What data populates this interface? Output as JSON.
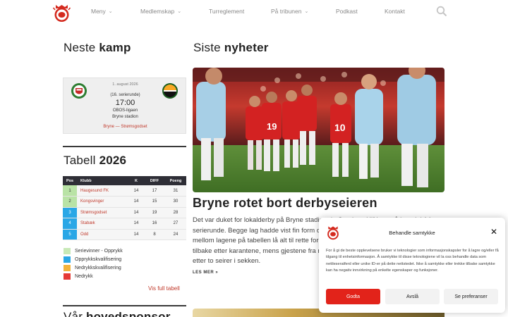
{
  "header": {
    "nav": [
      {
        "label": "Meny",
        "dropdown": true
      },
      {
        "label": "Medlemskap",
        "dropdown": true
      },
      {
        "label": "Turreglement",
        "dropdown": false
      },
      {
        "label": "På tribunen",
        "dropdown": true
      },
      {
        "label": "Podkast",
        "dropdown": false
      },
      {
        "label": "Kontakt",
        "dropdown": false
      }
    ]
  },
  "next_match": {
    "title_light": "Neste",
    "title_bold": "kamp",
    "date": "1. august 2026",
    "round": "(16. serierunde)",
    "time": "17:00",
    "league": "OBOS-ligaen",
    "venue": "Bryne stadion",
    "teams": "Bryne — Strømsgodset"
  },
  "table": {
    "title_light": "Tabell",
    "title_bold": "2026",
    "headers": [
      "Pos",
      "Klubb",
      "K",
      "DIFF",
      "Poeng"
    ],
    "rows": [
      {
        "pos": "1",
        "club": "Haugesund FK",
        "k": "14",
        "diff": "17",
        "pts": "31",
        "zone": "green"
      },
      {
        "pos": "2",
        "club": "Kongsvinger",
        "k": "14",
        "diff": "15",
        "pts": "30",
        "zone": "green"
      },
      {
        "pos": "3",
        "club": "Strømsgodset",
        "k": "14",
        "diff": "19",
        "pts": "28",
        "zone": "blue"
      },
      {
        "pos": "4",
        "club": "Stabæk",
        "k": "14",
        "diff": "16",
        "pts": "27",
        "zone": "blue"
      },
      {
        "pos": "5",
        "club": "Odd",
        "k": "14",
        "diff": "8",
        "pts": "24",
        "zone": "blue"
      }
    ],
    "legend": [
      {
        "label": "Serievinner - Opprykk",
        "color": "#c8e9b7"
      },
      {
        "label": "Opprykkskvalifisering",
        "color": "#2aa7e6"
      },
      {
        "label": "Nedrykkskvalifisering",
        "color": "#f2b33d"
      },
      {
        "label": "Nedrykk",
        "color": "#e53935"
      }
    ],
    "full_link": "Vis full tabell"
  },
  "sponsor": {
    "title_light": "Vår",
    "title_bold": "hovedsponsor"
  },
  "news": {
    "title_light": "Siste",
    "title_bold": "nyheter",
    "article_title": "Bryne rotet bort derbyseieren",
    "excerpt": "Det var duket for lokalderby på Bryne stadion da Sandnes Ulf kom på besøk i 14. serierunde. Begge lag hadde vist fin form de siste rundene og bare tre poeng skilte mellom lagene på tabellen lå alt til rette for en storkamp. Dessuten var lagkaptein tilbake etter karantene, mens gjestene fra nord hadde med seg formsterke spillere etter to seirer i sekken.",
    "read_more": "LES MER »"
  },
  "consent": {
    "title": "Behandle samtykke",
    "text": "For å gi de beste opplevelsene bruker vi teknologier som informasjonskapsler for å lagre og/eller få tilgang til enhetsinformasjon. Å samtykke til disse teknologiene vil la oss behandle data som nettleseratferd eller unike ID-er på dette nettstedet. Ikke å samtykke eller trekke tilbake samtykke kan ha negativ innvirkning på enkelte egenskaper og funksjoner.",
    "accept": "Godta",
    "deny": "Avslå",
    "prefs": "Se preferanser"
  },
  "colors": {
    "accent_red": "#e2231a",
    "dark_header": "#2e2e36",
    "promotion_blue": "#2aa7e6",
    "winner_green": "#b9e3a6"
  }
}
